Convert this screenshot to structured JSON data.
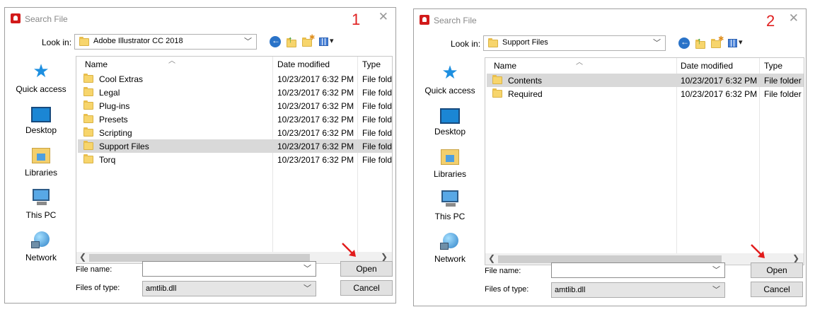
{
  "dialogs": [
    {
      "title": "Search File",
      "step": "1",
      "look_in_label": "Look in:",
      "look_in_value": "Adobe Illustrator CC 2018",
      "places": [
        "Quick access",
        "Desktop",
        "Libraries",
        "This PC",
        "Network"
      ],
      "columns": {
        "name": "Name",
        "date": "Date modified",
        "type": "Type"
      },
      "rows": [
        {
          "name": "Cool Extras",
          "date": "10/23/2017 6:32 PM",
          "type": "File folder",
          "selected": false
        },
        {
          "name": "Legal",
          "date": "10/23/2017 6:32 PM",
          "type": "File folder",
          "selected": false
        },
        {
          "name": "Plug-ins",
          "date": "10/23/2017 6:32 PM",
          "type": "File folder",
          "selected": false
        },
        {
          "name": "Presets",
          "date": "10/23/2017 6:32 PM",
          "type": "File folder",
          "selected": false
        },
        {
          "name": "Scripting",
          "date": "10/23/2017 6:32 PM",
          "type": "File folder",
          "selected": false
        },
        {
          "name": "Support Files",
          "date": "10/23/2017 6:32 PM",
          "type": "File folder",
          "selected": true
        },
        {
          "name": "Torq",
          "date": "10/23/2017 6:32 PM",
          "type": "File folder",
          "selected": false
        }
      ],
      "file_name_label": "File name:",
      "file_name_value": "",
      "files_of_type_label": "Files of type:",
      "files_of_type_value": "amtlib.dll",
      "open_label": "Open",
      "cancel_label": "Cancel"
    },
    {
      "title": "Search File",
      "step": "2",
      "look_in_label": "Look in:",
      "look_in_value": "Support Files",
      "places": [
        "Quick access",
        "Desktop",
        "Libraries",
        "This PC",
        "Network"
      ],
      "columns": {
        "name": "Name",
        "date": "Date modified",
        "type": "Type"
      },
      "rows": [
        {
          "name": "Contents",
          "date": "10/23/2017 6:32 PM",
          "type": "File folder",
          "selected": true
        },
        {
          "name": "Required",
          "date": "10/23/2017 6:32 PM",
          "type": "File folder",
          "selected": false
        }
      ],
      "file_name_label": "File name:",
      "file_name_value": "",
      "files_of_type_label": "Files of type:",
      "files_of_type_value": "amtlib.dll",
      "open_label": "Open",
      "cancel_label": "Cancel"
    }
  ],
  "colors": {
    "step_number": "#e02020",
    "selection": "#d9d9d9",
    "accent": "#1d8fe0"
  }
}
